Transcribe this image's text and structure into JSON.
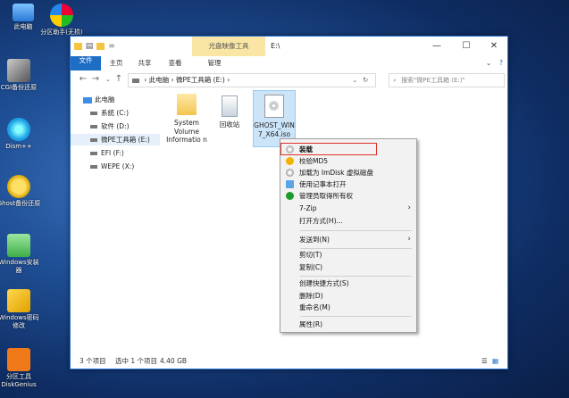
{
  "desktop": {
    "icons": [
      {
        "label": "此电脑"
      },
      {
        "label": "分区助手(无损)"
      },
      {
        "label": "CGI备份还原"
      },
      {
        "label": "Dism++"
      },
      {
        "label": "Ghost备份还原"
      },
      {
        "label": "Windows安装器"
      },
      {
        "label": "Windows密码修改"
      },
      {
        "label": "分区工具DiskGenius"
      }
    ]
  },
  "window": {
    "title": "E:\\",
    "context_tab": "光盘映像工具",
    "controls": {
      "minimize": "—",
      "maximize": "☐",
      "close": "✕"
    },
    "ribbon_tabs": [
      "文件",
      "主页",
      "共享",
      "查看",
      "管理"
    ],
    "address": "› 此电脑 › 微PE工具箱 (E:) ›",
    "search_placeholder": "搜索\"微PE工具箱 (E:)\"",
    "nav": [
      {
        "label": "此电脑"
      },
      {
        "label": "系统 (C:)"
      },
      {
        "label": "软件 (D:)"
      },
      {
        "label": "微PE工具箱 (E:)"
      },
      {
        "label": "EFI (F:)"
      },
      {
        "label": "WEPE (X:)"
      }
    ],
    "files": [
      {
        "label": "System Volume Informatio n"
      },
      {
        "label": "回收站"
      },
      {
        "label": "GHOST_WIN7_X64.iso"
      }
    ],
    "status": {
      "count": "3 个项目",
      "selected": "选中 1 个项目",
      "size": "4.40 GB"
    }
  },
  "context_menu": {
    "items": [
      {
        "label": "装载",
        "icon": "disc-icon"
      },
      {
        "label": "校验MD5",
        "icon": "shield-icon"
      },
      {
        "label": "加载为 ImDisk 虚拟磁盘",
        "icon": "disk-icon"
      },
      {
        "label": "使用记事本打开",
        "icon": "notepad-icon"
      },
      {
        "label": "管理员取得所有权",
        "icon": "shield-check-icon"
      },
      {
        "label": "7-Zip",
        "arrow": "›"
      },
      {
        "label": "打开方式(H)..."
      },
      {
        "label": "发送到(N)",
        "arrow": "›"
      },
      {
        "label": "剪切(T)"
      },
      {
        "label": "复制(C)"
      },
      {
        "label": "创建快捷方式(S)"
      },
      {
        "label": "删除(D)"
      },
      {
        "label": "重命名(M)"
      },
      {
        "label": "属性(R)"
      }
    ]
  },
  "colors": {
    "accent": "#1f6ec6",
    "highlight": "#e0302a",
    "context_tab": "#f9e6a4"
  }
}
